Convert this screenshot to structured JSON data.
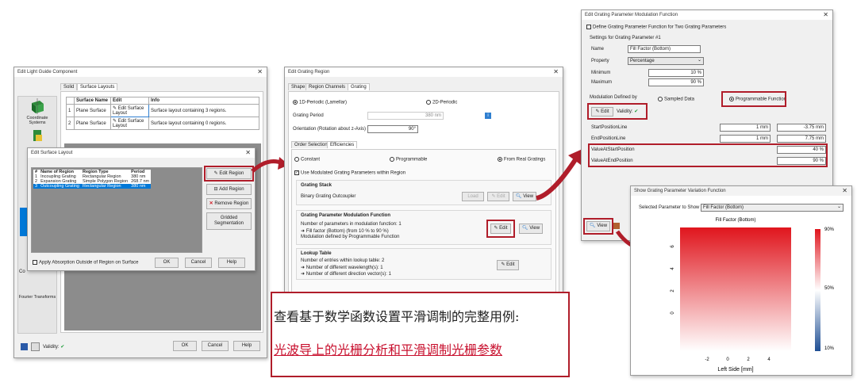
{
  "lgc": {
    "title": "Edit Light Guide Component",
    "tab_solid": "Solid",
    "tab_layouts": "Surface Layouts",
    "side": {
      "coord": "Coordinate Systems",
      "fourier": "Fourier Transforms",
      "co": "Co"
    },
    "cols": [
      "Surface Name",
      "Edit",
      "Info"
    ],
    "rows": [
      {
        "n": "1",
        "name": "Plane Surface",
        "edit": "Edit Surface Layout",
        "info": "Surface layout containing 3 regions."
      },
      {
        "n": "2",
        "name": "Plane Surface",
        "edit": "Edit Surface Layout",
        "info": "Surface layout containing 0 regions."
      }
    ],
    "validity": "Validity:",
    "ok": "OK",
    "cancel": "Cancel",
    "help": "Help"
  },
  "esl": {
    "title": "Edit Surface Layout",
    "cols": [
      "#",
      "Name of Region",
      "Region Type",
      "Period"
    ],
    "rows": [
      [
        "1",
        "Incoupling Grating",
        "Rectangular Region",
        "380 nm"
      ],
      [
        "2",
        "Expansion Grating",
        "Simple Polygon Region",
        "268.7 nm"
      ],
      [
        "3",
        "Outcoupling Grating",
        "Rectangular Region",
        "380 nm"
      ]
    ],
    "edit_region": "Edit Region",
    "add_region": "Add Region",
    "remove_region": "Remove Region",
    "gridded": "Gridded Segmentation",
    "apply_abs": "Apply Absorption Outside of Region on Surface",
    "ok": "OK",
    "cancel": "Cancel",
    "help": "Help"
  },
  "egr": {
    "title": "Edit Grating Region",
    "tabs": [
      "Shape",
      "Region Channels",
      "Grating"
    ],
    "r1d": "1D-Periodic (Lamellar)",
    "r2d": "2D-Periodic",
    "period_label": "Grating Period",
    "period_val": "380 nm",
    "orient_label": "Orientation (Rotation about z-Axis)",
    "orient_val": "90°",
    "subtabs": [
      "Order Selection",
      "Efficiencies"
    ],
    "constant": "Constant",
    "programmable": "Programmable",
    "from_real": "From Real Gratings",
    "use_mod": "Use Modulated Grating Parameters within Region",
    "stack_title": "Grating Stack",
    "stack_name": "Binary Grating Outcoupler",
    "load": "Load",
    "edit": "Edit",
    "view": "View",
    "gpmf_title": "Grating Parameter Modulation Function",
    "gpmf_l1": "Number of parameters in modulation function: 1",
    "gpmf_l2": "➜ Fill factor (Bottom) (from 10 % to 90 %)",
    "gpmf_l3": "Modulation defined by Programmable Function",
    "lut_title": "Lookup Table",
    "lut_l1": "Number of entries within lookup table: 2",
    "lut_l2": "➜ Number of different wavelength(s): 1",
    "lut_l3": "➜ Number of different direction vector(s): 1"
  },
  "caption": {
    "line1": "查看基于数学函数设置平滑调制的完整用例:",
    "line2": "光波导上的光栅分析和平滑调制光栅参数"
  },
  "egpm": {
    "title": "Edit Grating Parameter Modulation Function",
    "define_two": "Define Grating Parameter Function for Two Grating Parameters",
    "settings": "Settings for Grating Parameter #1",
    "name_l": "Name",
    "name_v": "Fill Factor (Bottom)",
    "prop_l": "Property",
    "prop_v": "Percentage",
    "min_l": "Minimum",
    "min_v": "10 %",
    "max_l": "Maximum",
    "max_v": "90 %",
    "mod_by": "Modulation Defined by",
    "sampled": "Sampled Data",
    "prog": "Programmable Function",
    "edit": "Edit",
    "validity": "Validity:",
    "params": [
      {
        "l": "StartPositionLine",
        "a": "1 mm",
        "b": "-3.75 mm"
      },
      {
        "l": "EndPositionLine",
        "a": "1 mm",
        "b": "7.75 mm"
      },
      {
        "l": "ValueAtStartPosition",
        "a": "",
        "b": "40 %"
      },
      {
        "l": "ValueAtEndPosition",
        "a": "",
        "b": "90 %"
      }
    ],
    "view": "View"
  },
  "sgpv": {
    "title": "Show Grating Parameter Variation Function",
    "sel_l": "Selected Parameter to Show",
    "sel_v": "Fill Factor (Bottom)",
    "plot_title": "Fill Factor (Bottom)",
    "xlabel": "Left Side [mm]"
  },
  "chart_data": {
    "type": "heatmap",
    "title": "Fill Factor (Bottom)",
    "xlabel": "Left Side [mm]",
    "ylabel": "",
    "x_ticks": [
      "-2",
      "0",
      "2",
      "4"
    ],
    "y_ticks": [
      "0",
      "2",
      "4",
      "6"
    ],
    "colorbar_ticks": [
      "90%",
      "50%",
      "10%"
    ],
    "colorbar_range": [
      10,
      90
    ],
    "colormap": [
      "#1f4f94",
      "#ffffff",
      "#e0151d"
    ]
  }
}
